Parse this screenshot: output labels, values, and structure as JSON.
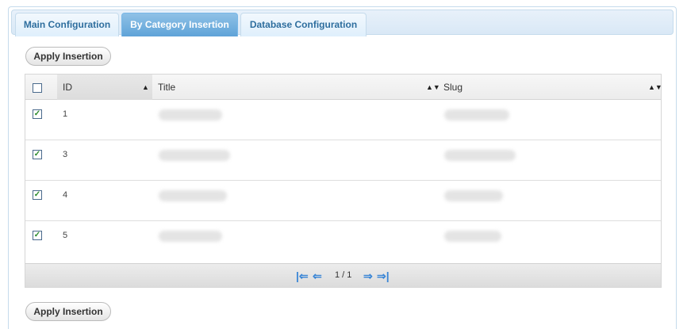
{
  "tabs": [
    {
      "label": "Main Configuration",
      "active": false
    },
    {
      "label": "By Category Insertion",
      "active": true
    },
    {
      "label": "Database Configuration",
      "active": false
    }
  ],
  "apply_button_label": "Apply Insertion",
  "grid": {
    "columns": {
      "select_all_checked": false,
      "id": "ID",
      "title": "Title",
      "slug": "Slug"
    },
    "rows": [
      {
        "id": "1",
        "checked": true
      },
      {
        "id": "3",
        "checked": true
      },
      {
        "id": "4",
        "checked": true
      },
      {
        "id": "5",
        "checked": true
      }
    ],
    "pager": {
      "page_info": "1 / 1",
      "first_icon": "first-page-icon",
      "prev_icon": "prev-page-icon",
      "next_icon": "next-page-icon",
      "last_icon": "last-page-icon"
    }
  }
}
